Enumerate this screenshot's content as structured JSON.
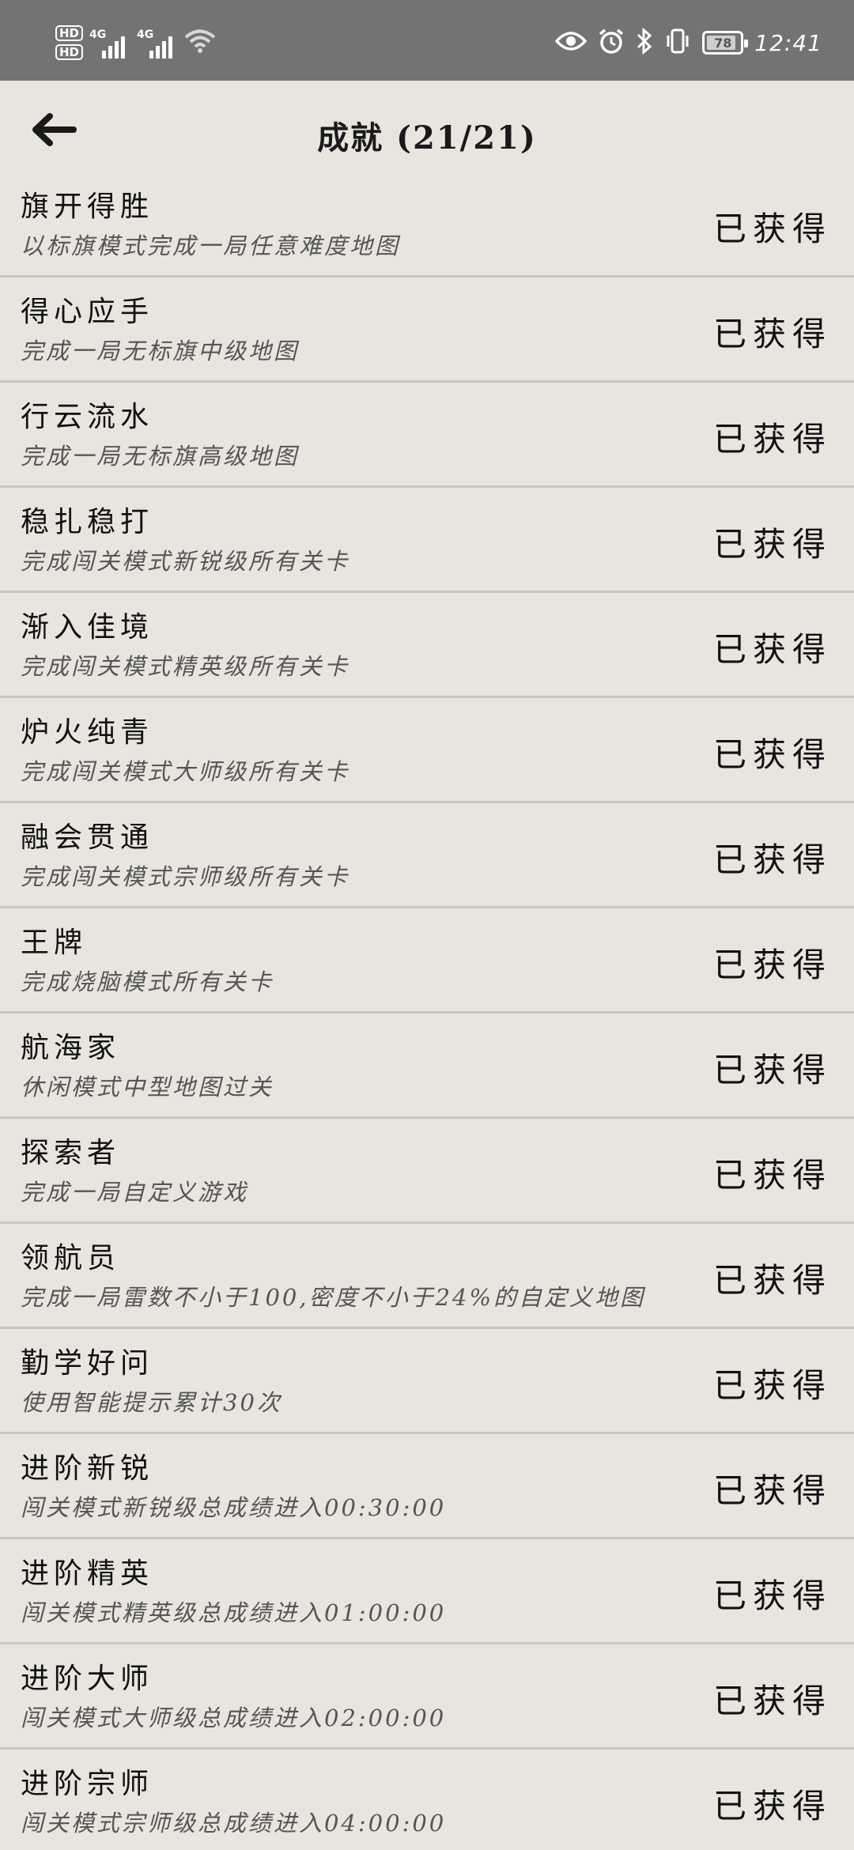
{
  "status_bar": {
    "hd1": "HD",
    "hd2": "HD",
    "sig1_label": "4G",
    "sig2_label": "4G",
    "battery": "78",
    "time": "12:41"
  },
  "header": {
    "title": "成就 (21/21)"
  },
  "achievements": [
    {
      "title": "旗开得胜",
      "desc": "以标旗模式完成一局任意难度地图",
      "status": "已获得"
    },
    {
      "title": "得心应手",
      "desc": "完成一局无标旗中级地图",
      "status": "已获得"
    },
    {
      "title": "行云流水",
      "desc": "完成一局无标旗高级地图",
      "status": "已获得"
    },
    {
      "title": "稳扎稳打",
      "desc": "完成闯关模式新锐级所有关卡",
      "status": "已获得"
    },
    {
      "title": "渐入佳境",
      "desc": "完成闯关模式精英级所有关卡",
      "status": "已获得"
    },
    {
      "title": "炉火纯青",
      "desc": "完成闯关模式大师级所有关卡",
      "status": "已获得"
    },
    {
      "title": "融会贯通",
      "desc": "完成闯关模式宗师级所有关卡",
      "status": "已获得"
    },
    {
      "title": "王牌",
      "desc": "完成烧脑模式所有关卡",
      "status": "已获得"
    },
    {
      "title": "航海家",
      "desc": "休闲模式中型地图过关",
      "status": "已获得"
    },
    {
      "title": "探索者",
      "desc": "完成一局自定义游戏",
      "status": "已获得"
    },
    {
      "title": "领航员",
      "desc": "完成一局雷数不小于100,密度不小于24%的自定义地图",
      "status": "已获得"
    },
    {
      "title": "勤学好问",
      "desc": "使用智能提示累计30次",
      "status": "已获得"
    },
    {
      "title": "进阶新锐",
      "desc": "闯关模式新锐级总成绩进入00:30:00",
      "status": "已获得"
    },
    {
      "title": "进阶精英",
      "desc": "闯关模式精英级总成绩进入01:00:00",
      "status": "已获得"
    },
    {
      "title": "进阶大师",
      "desc": "闯关模式大师级总成绩进入02:00:00",
      "status": "已获得"
    },
    {
      "title": "进阶宗师",
      "desc": "闯关模式宗师级总成绩进入04:00:00",
      "status": "已获得"
    }
  ]
}
